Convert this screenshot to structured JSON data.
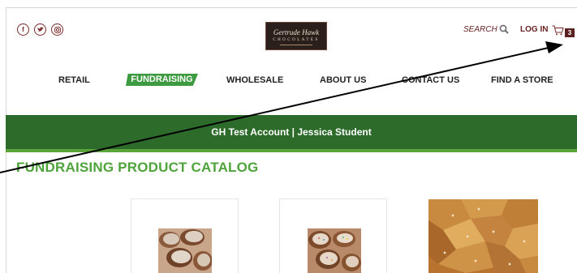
{
  "header": {
    "social_icons": [
      "facebook-icon",
      "twitter-icon",
      "instagram-icon"
    ],
    "logo": {
      "line1": "Gertrude Hawk",
      "line2": "CHOCOLATES"
    },
    "search_label": "SEARCH",
    "login_label": "LOG IN",
    "cart_count": "3"
  },
  "nav": {
    "items": [
      "RETAIL",
      "FUNDRAISING",
      "WHOLESALE",
      "ABOUT US",
      "CONTACT US",
      "FIND A STORE"
    ],
    "active": "FUNDRAISING"
  },
  "banner": {
    "text": "GH Test Account | Jessica Student"
  },
  "catalog": {
    "title": "FUNDRAISING PRODUCT CATALOG"
  },
  "colors": {
    "accent_green": "#3e9a40",
    "banner_green": "#2d6b2b",
    "brand_maroon": "#6b2323"
  }
}
